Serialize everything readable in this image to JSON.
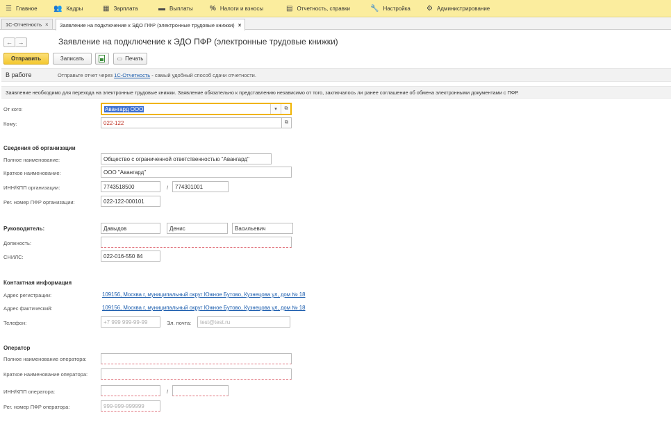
{
  "menu": [
    {
      "label": "Главное",
      "icon": "menu-icon"
    },
    {
      "label": "Кадры",
      "icon": "users-icon"
    },
    {
      "label": "Зарплата",
      "icon": "calculator-icon"
    },
    {
      "label": "Выплаты",
      "icon": "cash-icon"
    },
    {
      "label": "Налоги и взносы",
      "icon": "percent-icon"
    },
    {
      "label": "Отчетность, справки",
      "icon": "report-icon"
    },
    {
      "label": "Настройка",
      "icon": "wrench-icon"
    },
    {
      "label": "Администрирование",
      "icon": "gear-icon"
    }
  ],
  "tabs": [
    {
      "label": "1С-Отчетность"
    },
    {
      "label": "Заявление на подключение к ЭДО ПФР (электронные трудовые книжки)"
    }
  ],
  "form": {
    "title": "Заявление на подключение к ЭДО ПФР (электронные трудовые книжки)",
    "toolbar": {
      "send": "Отправить",
      "save": "Записать",
      "print": "Печать"
    },
    "status": {
      "label": "В работе",
      "text_before": "Отправьте отчет через",
      "link": "1С-Отчетность",
      "text_after": "- самый удобный способ сдачи отчетности."
    },
    "notice": "Заявление необходимо для перехода на электронные трудовые книжки. Заявление обязательно к представлению независимо от того, заключалось ли ранее соглашение об обмена электронными документами с ПФР.",
    "from_label": "От кого:",
    "from_value": "Авангард ООО",
    "to_label": "Кому:",
    "to_value": "022-122",
    "org": {
      "heading": "Сведения об организации",
      "full_name_label": "Полное наименование:",
      "full_name": "Общество с ограниченной ответственностью \"Авангард\"",
      "short_name_label": "Краткое наименование:",
      "short_name": "ООО \"Авангард\"",
      "inn_kpp_label": "ИНН/КПП организации:",
      "inn": "7743518500",
      "kpp": "774301001",
      "separator": "/",
      "pfr_label": "Рег. номер ПФР организации:",
      "pfr": "022-122-000101"
    },
    "head": {
      "heading": "Руководитель:",
      "last_name": "Давыдов",
      "first_name": "Денис",
      "middle_name": "Васильевич",
      "position_label": "Должность:",
      "position": "",
      "snils_label": "СНИЛС:",
      "snils": "022-016-550 84"
    },
    "contacts": {
      "heading": "Контактная информация",
      "reg_address_label": "Адрес регистрации:",
      "reg_address": "109156, Москва г, муниципальный округ Южное Бутово, Кузнецова ул, дом № 18",
      "fact_address_label": "Адрес фактический:",
      "fact_address": "109156, Москва г, муниципальный округ Южное Бутово, Кузнецова ул, дом № 18",
      "phone_label": "Телефон:",
      "phone_placeholder": "+7 999 999-99-99",
      "email_label": "Эл. почта:",
      "email_placeholder": "test@test.ru"
    },
    "operator": {
      "heading": "Оператор",
      "full_name_label": "Полное наименование оператора:",
      "short_name_label": "Краткое наименование оператора:",
      "inn_kpp_label": "ИНН/КПП оператора:",
      "separator": "/",
      "pfr_label": "Рег. номер ПФР оператора:",
      "pfr_placeholder": "999-999-999999"
    }
  },
  "colors": {
    "menubar": "#fbed9e",
    "primary_button": "#f4c830",
    "link": "#1a5cad",
    "required_underline": "#e0707a",
    "to_value": "#c0392b",
    "focus_border": "#f0b400"
  }
}
